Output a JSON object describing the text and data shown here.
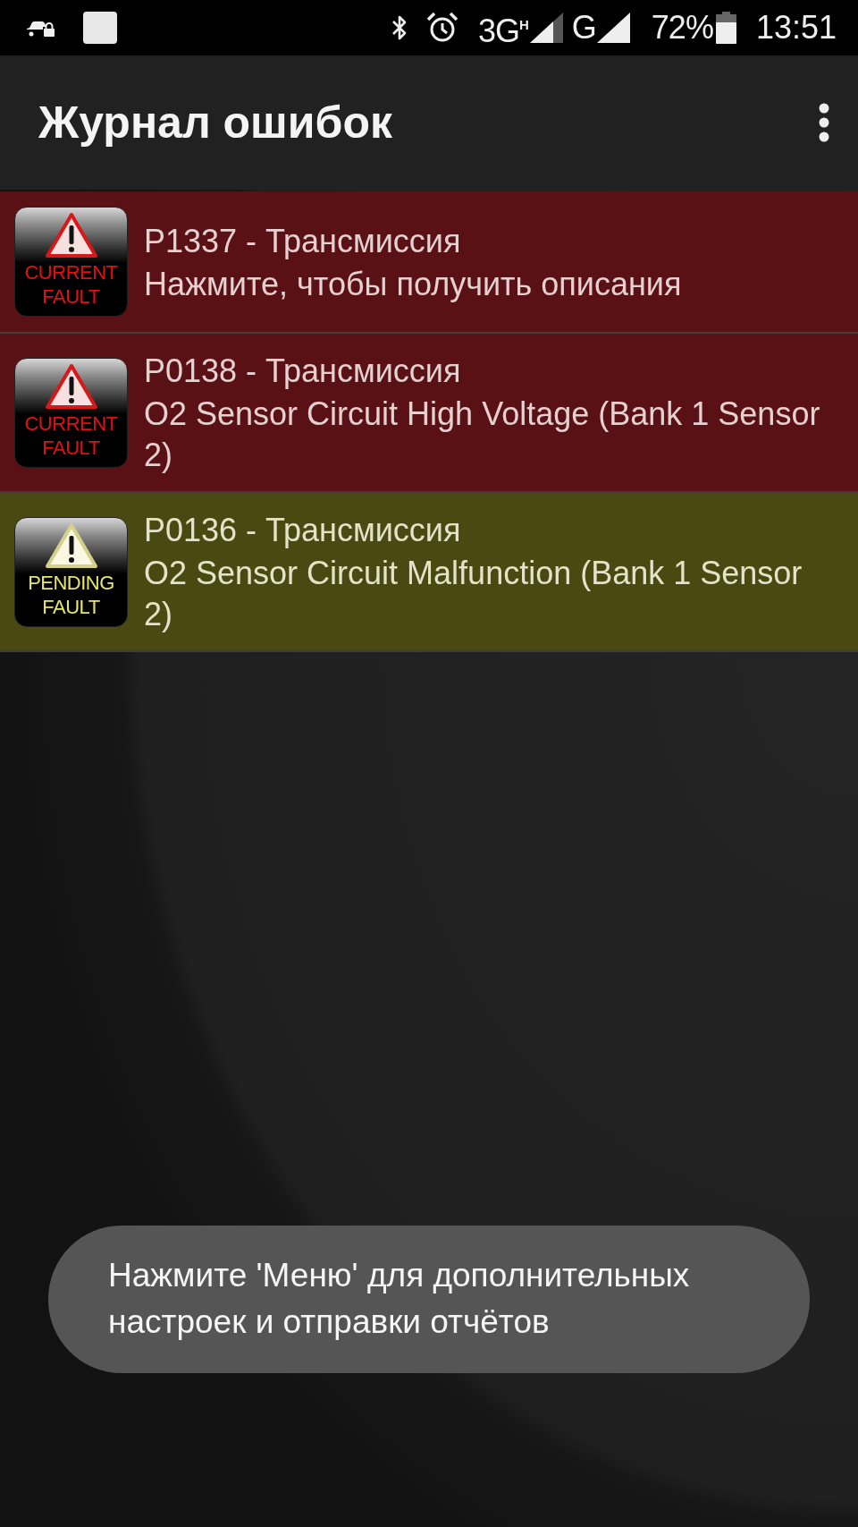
{
  "status_bar": {
    "network": "3G$^{H}$",
    "network_2": "G",
    "battery": "72%",
    "time": "13:51"
  },
  "app_bar": {
    "title": "Журнал ошибок"
  },
  "faults": [
    {
      "kind": "current",
      "badge": "CURRENT FAULT",
      "title": "P1337 - Трансмиссия",
      "description": "Нажмите, чтобы получить описания"
    },
    {
      "kind": "current",
      "badge": "CURRENT FAULT",
      "title": "P0138 - Трансмиссия",
      "description": "O2 Sensor Circuit High Voltage (Bank 1 Sensor 2)"
    },
    {
      "kind": "pending",
      "badge": "PENDING FAULT",
      "title": "P0136 - Трансмиссия",
      "description": "O2 Sensor Circuit Malfunction (Bank 1 Sensor 2)"
    }
  ],
  "toast": {
    "text": "Нажмите 'Меню' для дополнительных настроек и отправки отчётов"
  }
}
